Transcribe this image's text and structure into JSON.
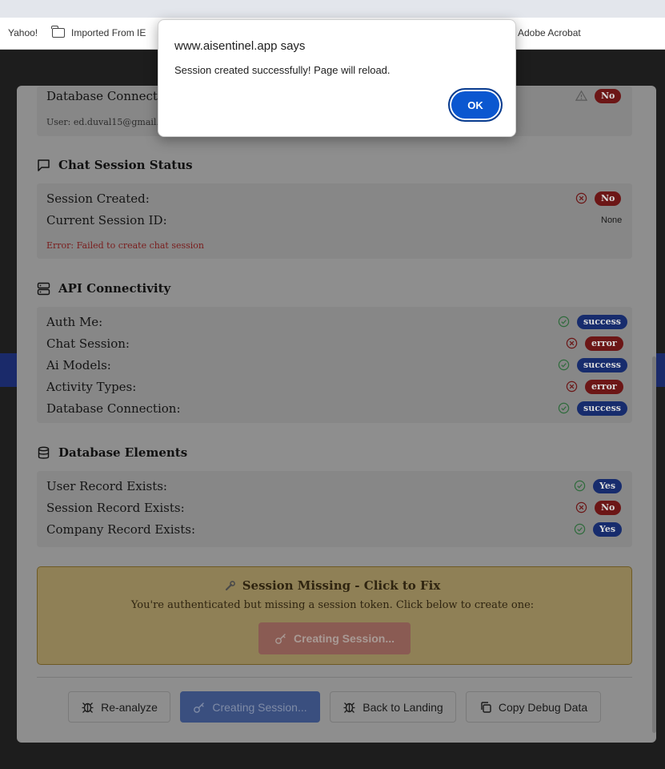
{
  "bookmarks": [
    {
      "label": "Yahoo!"
    },
    {
      "label": "Imported From IE"
    },
    {
      "label": "Adobe Acrobat"
    }
  ],
  "alert": {
    "title": "www.aisentinel.app says",
    "message": "Session created successfully! Page will reload.",
    "ok_label": "OK"
  },
  "auth_section": {
    "rows": [
      {
        "label": "Database Connected:",
        "status": "warning",
        "badge": "No"
      }
    ],
    "user_note": "User: ed.duval15@gmail.com"
  },
  "chat_section": {
    "title": "Chat Session Status",
    "rows": [
      {
        "label": "Session Created:",
        "status": "error",
        "badge": "No"
      },
      {
        "label": "Current Session ID:",
        "value": "None"
      }
    ],
    "error": "Error: Failed to create chat session"
  },
  "api_section": {
    "title": "API Connectivity",
    "rows": [
      {
        "label": "Auth Me:",
        "status": "ok",
        "badge": "success"
      },
      {
        "label": "Chat Session:",
        "status": "error",
        "badge": "error"
      },
      {
        "label": "Ai Models:",
        "status": "ok",
        "badge": "success"
      },
      {
        "label": "Activity Types:",
        "status": "error",
        "badge": "error"
      },
      {
        "label": "Database Connection:",
        "status": "ok",
        "badge": "success"
      }
    ]
  },
  "db_section": {
    "title": "Database Elements",
    "rows": [
      {
        "label": "User Record Exists:",
        "status": "ok",
        "badge": "Yes"
      },
      {
        "label": "Session Record Exists:",
        "status": "error",
        "badge": "No"
      },
      {
        "label": "Company Record Exists:",
        "status": "ok",
        "badge": "Yes"
      }
    ]
  },
  "fix": {
    "title": "Session Missing - Click to Fix",
    "description": "You're authenticated but missing a session token. Click below to create one:",
    "button_label": "Creating Session..."
  },
  "footer": {
    "reanalyze": "Re-analyze",
    "creating": "Creating Session...",
    "back": "Back to Landing",
    "copy": "Copy Debug Data"
  },
  "colors": {
    "ok_icon": "#2f6b3c",
    "error_icon": "#6c1616",
    "alert_button": "#0b57d0"
  }
}
